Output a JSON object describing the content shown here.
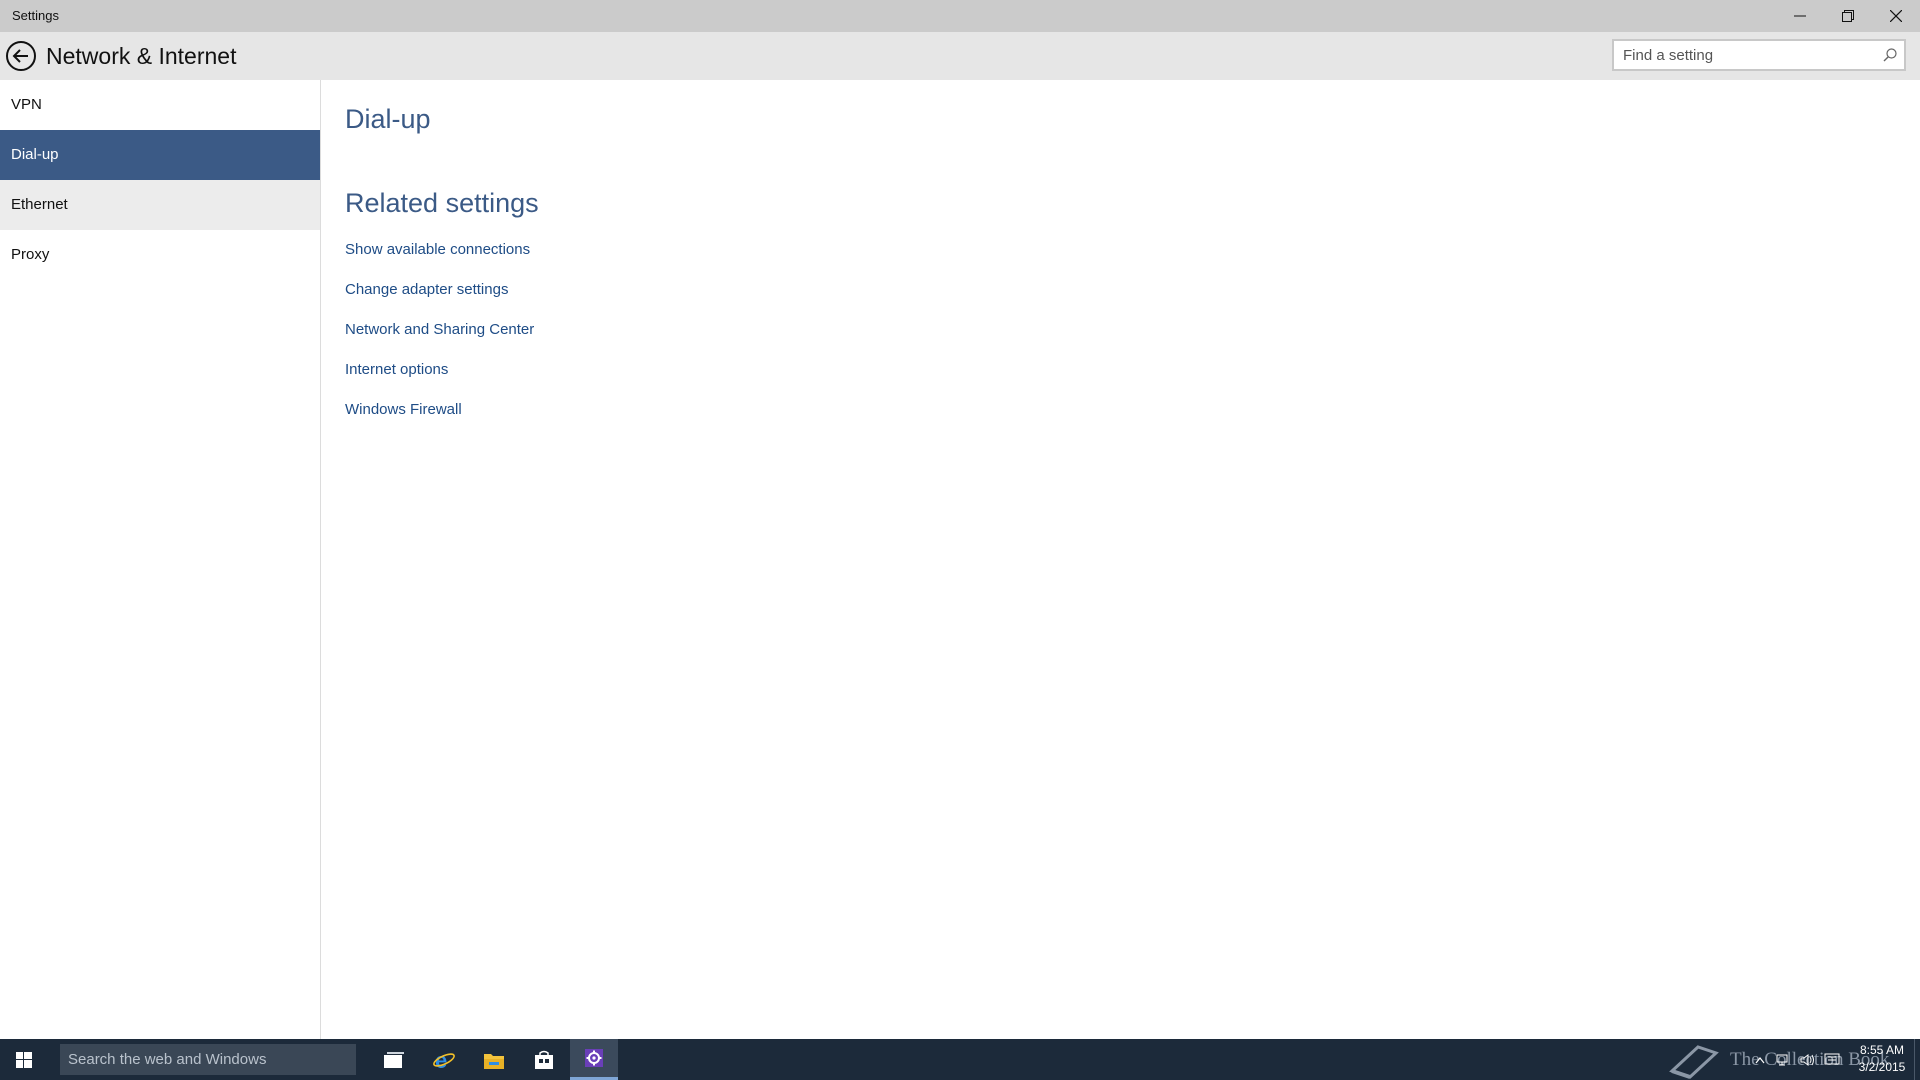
{
  "window": {
    "title": "Settings",
    "minimize_label": "",
    "restore_label": "",
    "close_label": ""
  },
  "header": {
    "page_title": "Network & Internet",
    "search_placeholder": "Find a setting"
  },
  "sidebar": {
    "items": [
      {
        "label": "VPN"
      },
      {
        "label": "Dial-up"
      },
      {
        "label": "Ethernet"
      },
      {
        "label": "Proxy"
      }
    ],
    "selected": "Dial-up"
  },
  "main": {
    "section_title": "Dial-up",
    "related_title": "Related settings",
    "links": [
      {
        "label": "Show available connections"
      },
      {
        "label": "Change adapter settings"
      },
      {
        "label": "Network and Sharing Center"
      },
      {
        "label": "Internet options"
      },
      {
        "label": "Windows Firewall"
      }
    ]
  },
  "taskbar": {
    "search_placeholder": "Search the web and Windows",
    "apps": [
      "task-view-icon",
      "internet-explorer-icon",
      "file-explorer-icon",
      "store-icon",
      "settings-icon"
    ],
    "watermark_text": "The Collection Book",
    "time": "8:55 AM",
    "date": "3/2/2015"
  },
  "colors": {
    "accent": "#3b5a86",
    "link": "#1e4c86",
    "titlebar": "#cbcbcb",
    "header": "#e6e6e6",
    "taskbar": "#1c2a3a"
  }
}
